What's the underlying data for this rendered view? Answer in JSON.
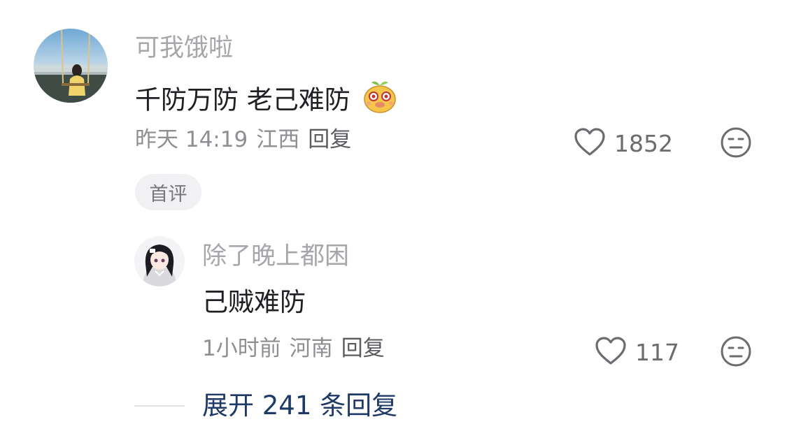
{
  "comment": {
    "username": "可我饿啦",
    "text": "千防万防 老己难防",
    "emoji_icon": "sprout-face-emoji-icon",
    "time": "昨天 14:19",
    "location": "江西",
    "reply_label": "回复",
    "like_count": "1852",
    "badge": "首评"
  },
  "reply": {
    "username": "除了晚上都困",
    "text": "己贼难防",
    "time": "1小时前",
    "location": "河南",
    "reply_label": "回复",
    "like_count": "117"
  },
  "expand": {
    "label": "展开 241 条回复"
  },
  "colors": {
    "username": "#a6a6ab",
    "text": "#1f1f24",
    "meta": "#8e8e93",
    "expand_link": "#1f3a66",
    "badge_bg": "#f1f1f3"
  }
}
